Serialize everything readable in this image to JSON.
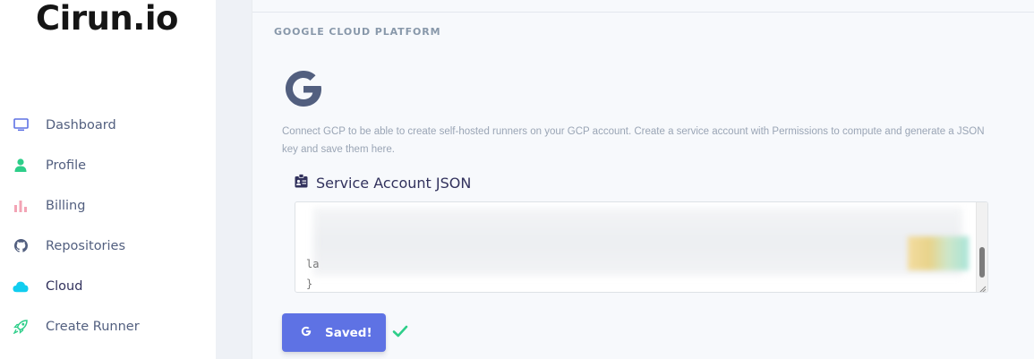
{
  "app": {
    "logo_text": "Cirun.io"
  },
  "sidebar": {
    "items": [
      {
        "label": "Dashboard",
        "icon": "monitor-icon",
        "color": "#5e72e4"
      },
      {
        "label": "Profile",
        "icon": "user-icon",
        "color": "#2dce89"
      },
      {
        "label": "Billing",
        "icon": "bar-chart-icon",
        "color": "#f3a4b5"
      },
      {
        "label": "Repositories",
        "icon": "github-icon",
        "color": "#525f7f"
      },
      {
        "label": "Cloud",
        "icon": "cloud-icon",
        "color": "#11cdef"
      },
      {
        "label": "Create Runner",
        "icon": "rocket-icon",
        "color": "#2dce89"
      }
    ],
    "active": "Cloud"
  },
  "main": {
    "section_title": "GOOGLE CLOUD PLATFORM",
    "provider_icon": "google-g-icon",
    "description": "Connect GCP to be able to create self-hosted runners on your GCP account. Create a service account with Permissions to compute and generate a JSON key and save them here.",
    "field_label": "Service Account JSON",
    "field_icon": "id-badge-icon",
    "json_visible_lines": [
      "la",
      "}"
    ],
    "save_button": {
      "label": "Saved!",
      "icon": "google-g-icon"
    },
    "status_icon": "check-icon"
  },
  "colors": {
    "primary": "#5e72e4",
    "success": "#2dce89",
    "text_dark": "#32325d",
    "text_muted": "#8898aa"
  }
}
